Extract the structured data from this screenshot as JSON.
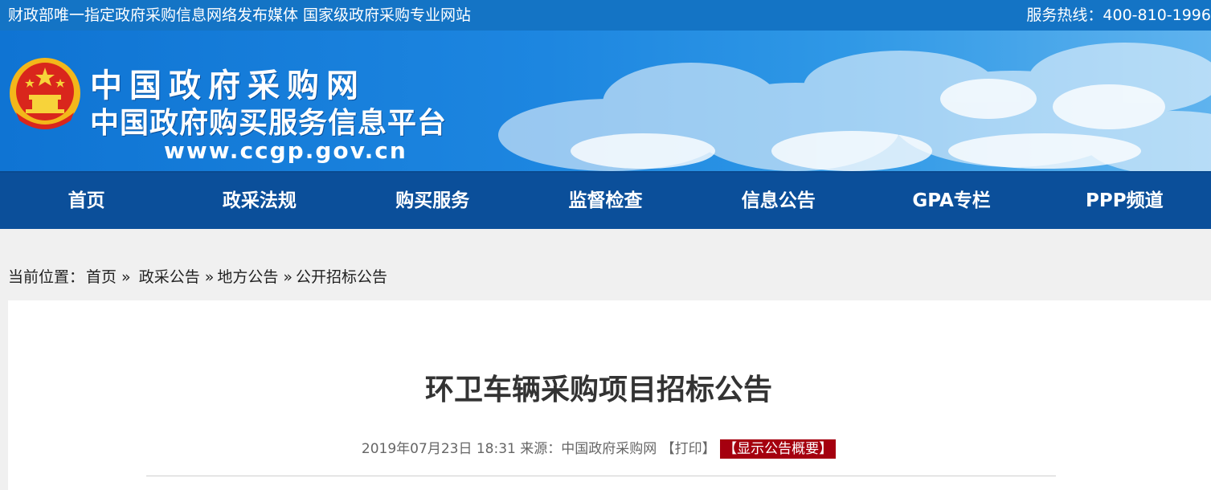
{
  "topbar": {
    "slogan": "财政部唯一指定政府采购信息网络发布媒体 国家级政府采购专业网站",
    "hotline": "服务热线：400-810-1996"
  },
  "header": {
    "logo_title": "中国政府采购网",
    "logo_subtitle": "中国政府购买服务信息平台",
    "logo_url": "www.ccgp.gov.cn"
  },
  "nav": {
    "items": [
      {
        "label": "首页"
      },
      {
        "label": "政采法规"
      },
      {
        "label": "购买服务"
      },
      {
        "label": "监督检查"
      },
      {
        "label": "信息公告"
      },
      {
        "label": "GPA专栏"
      },
      {
        "label": "PPP频道"
      }
    ]
  },
  "breadcrumb": {
    "prefix": "当前位置：",
    "items": [
      "首页",
      "政采公告",
      "地方公告",
      "公开招标公告"
    ],
    "separator": "»"
  },
  "article": {
    "title": "环卫车辆采购项目招标公告",
    "date": "2019年07月23日 18:31",
    "source": "来源：中国政府采购网",
    "print_label": "【打印】",
    "summary_label": "【显示公告概要】"
  },
  "colors": {
    "topbar_bg": "#1474c5",
    "nav_bg": "#0b4f9a",
    "summary_btn_bg": "#a5000f"
  }
}
